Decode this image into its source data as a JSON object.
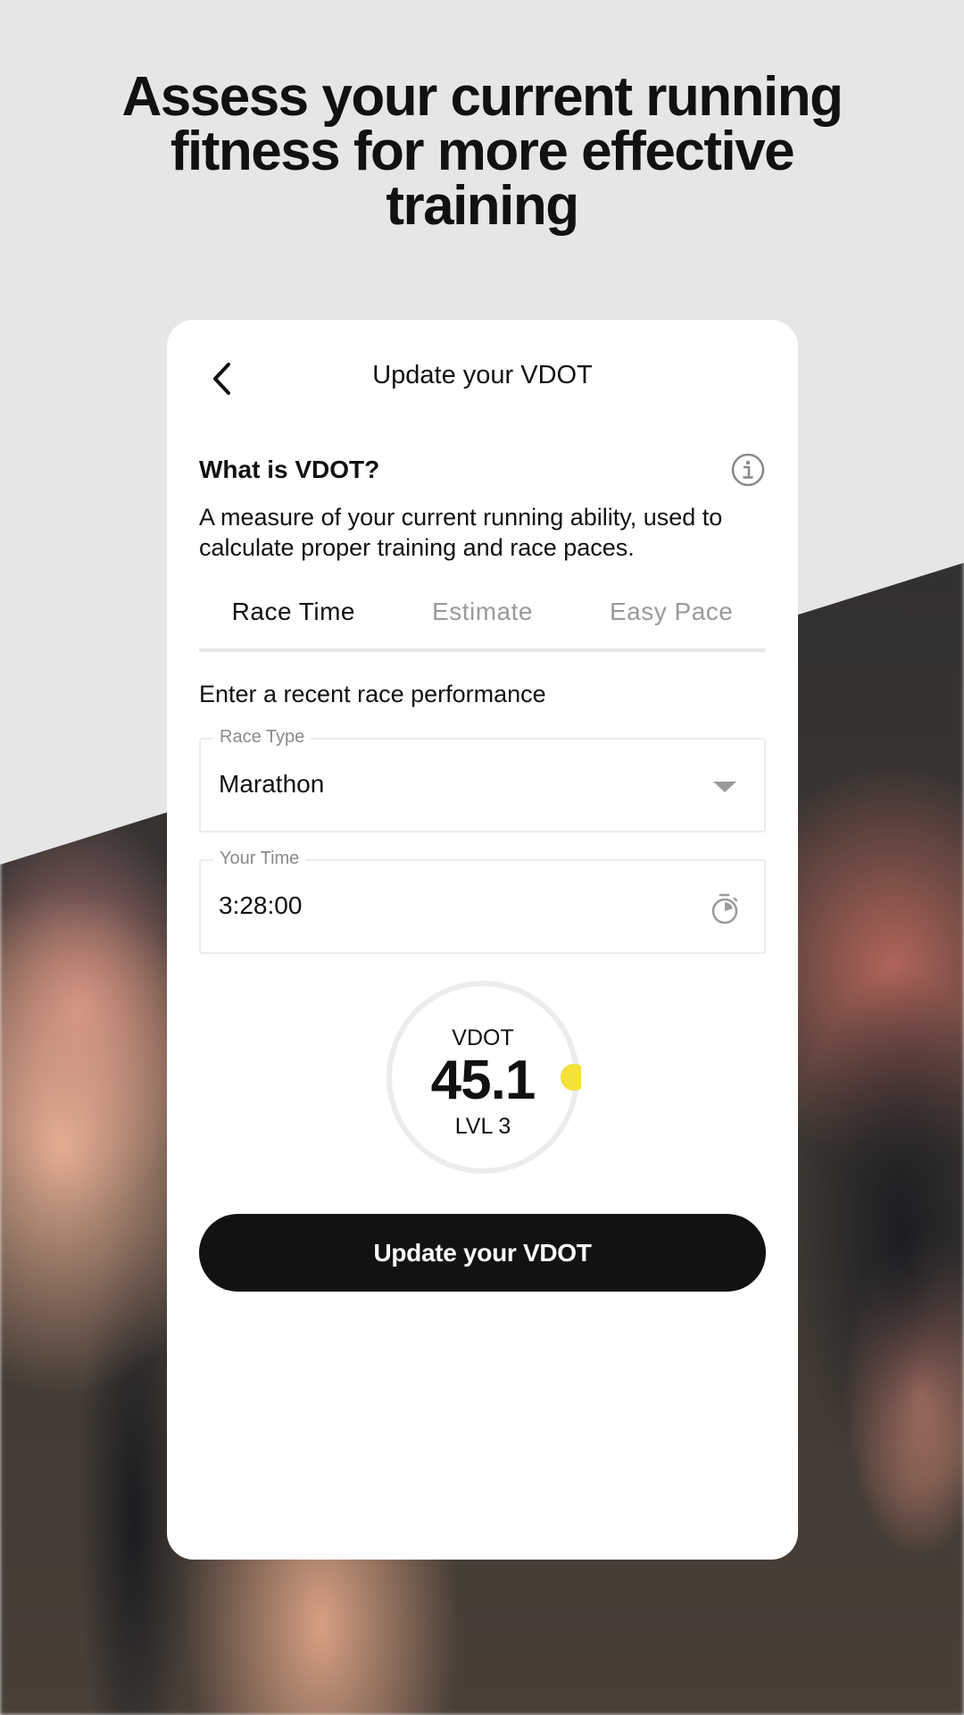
{
  "headline": "Assess your current running fitness for more effective training",
  "card": {
    "title": "Update your VDOT",
    "back_icon": "chevron-left-icon",
    "info": {
      "title": "What is VDOT?",
      "description": "A measure of your current running ability, used to calculate proper training and race paces.",
      "icon": "info-icon"
    },
    "tabs": [
      {
        "label": "Race Time",
        "active": true
      },
      {
        "label": "Estimate",
        "active": false
      },
      {
        "label": "Easy Pace",
        "active": false
      }
    ],
    "section_label": "Enter a recent race performance",
    "race_type": {
      "label": "Race Type",
      "value": "Marathon",
      "icon": "dropdown-arrow-icon"
    },
    "your_time": {
      "label": "Your Time",
      "value": "3:28:00",
      "icon": "stopwatch-icon"
    },
    "vdot": {
      "label": "VDOT",
      "value": "45.1",
      "level": "LVL 3",
      "indicator_color": "#f5e13a",
      "ring_color": "#ececec"
    },
    "submit_label": "Update your VDOT"
  },
  "colors": {
    "background": "#e6e6e6",
    "card": "#ffffff",
    "primary_button": "#121212",
    "text": "#111111",
    "muted": "#9a9a9a"
  }
}
